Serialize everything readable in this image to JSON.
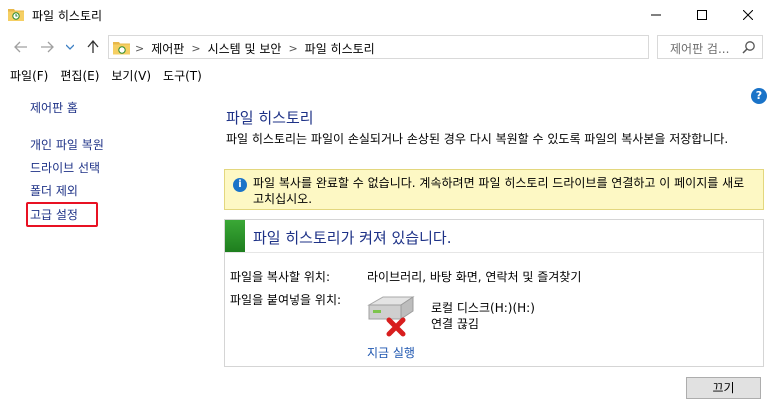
{
  "window": {
    "title": "파일 히스토리",
    "controls": {
      "minimize": "—",
      "maximize": "☐",
      "close": "✕"
    }
  },
  "address": {
    "breadcrumbs": [
      "제어판",
      "시스템 및 보안",
      "파일 히스토리"
    ],
    "search_placeholder": "제어판 검..."
  },
  "menu": [
    "파일(F)",
    "편집(E)",
    "보기(V)",
    "도구(T)"
  ],
  "sidebar": {
    "home": "제어판 홈",
    "items": [
      "개인 파일 복원",
      "드라이브 선택",
      "폴더 제외",
      "고급 설정"
    ],
    "highlighted_index": 3
  },
  "main": {
    "title": "파일 히스토리",
    "description": "파일 히스토리는 파일이 손실되거나 손상된 경우 다시 복원할 수 있도록 파일의 복사본을 저장합니다.",
    "warning": "파일 복사를 완료할 수 없습니다. 계속하려면 파일 히스토리 드라이브를 연결하고 이 페이지를 새로 고치십시오.",
    "status_heading": "파일 히스토리가 켜져 있습니다.",
    "copy_from_label": "파일을 복사할 위치:",
    "copy_from_value": "라이브러리, 바탕 화면, 연락처 및 즐겨찾기",
    "copy_to_label": "파일을 붙여넣을 위치:",
    "drive_name": "로컬 디스크(H:)(H:)",
    "drive_status": "연결 끊김",
    "run_now": "지금 실행",
    "turn_off": "끄기"
  },
  "colors": {
    "link": "#1e3287",
    "highlight_border": "#e81123",
    "warning_bg": "#fdf8c4",
    "status_green": "#2e9a2e"
  }
}
